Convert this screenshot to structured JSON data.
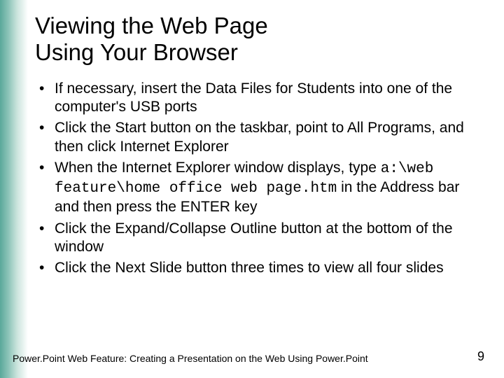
{
  "title_line1": "Viewing the Web Page",
  "title_line2": "Using Your Browser",
  "bullets": [
    {
      "pre": "If necessary, insert the Data Files for Students into one of the computer's USB ports",
      "mono": "",
      "post": ""
    },
    {
      "pre": "Click the Start button on the taskbar, point to All Programs, and then click Internet Explorer",
      "mono": "",
      "post": ""
    },
    {
      "pre": "When the Internet Explorer window displays, type ",
      "mono": "a:\\web feature\\home office web page.htm",
      "post": " in the Address bar and then press the ENTER key"
    },
    {
      "pre": "Click the Expand/Collapse Outline button at the bottom of the window",
      "mono": "",
      "post": ""
    },
    {
      "pre": "Click the Next Slide button three times to view all four slides",
      "mono": "",
      "post": ""
    }
  ],
  "footer": "Power.Point Web Feature: Creating a Presentation on the Web Using Power.Point",
  "page_number": "9"
}
